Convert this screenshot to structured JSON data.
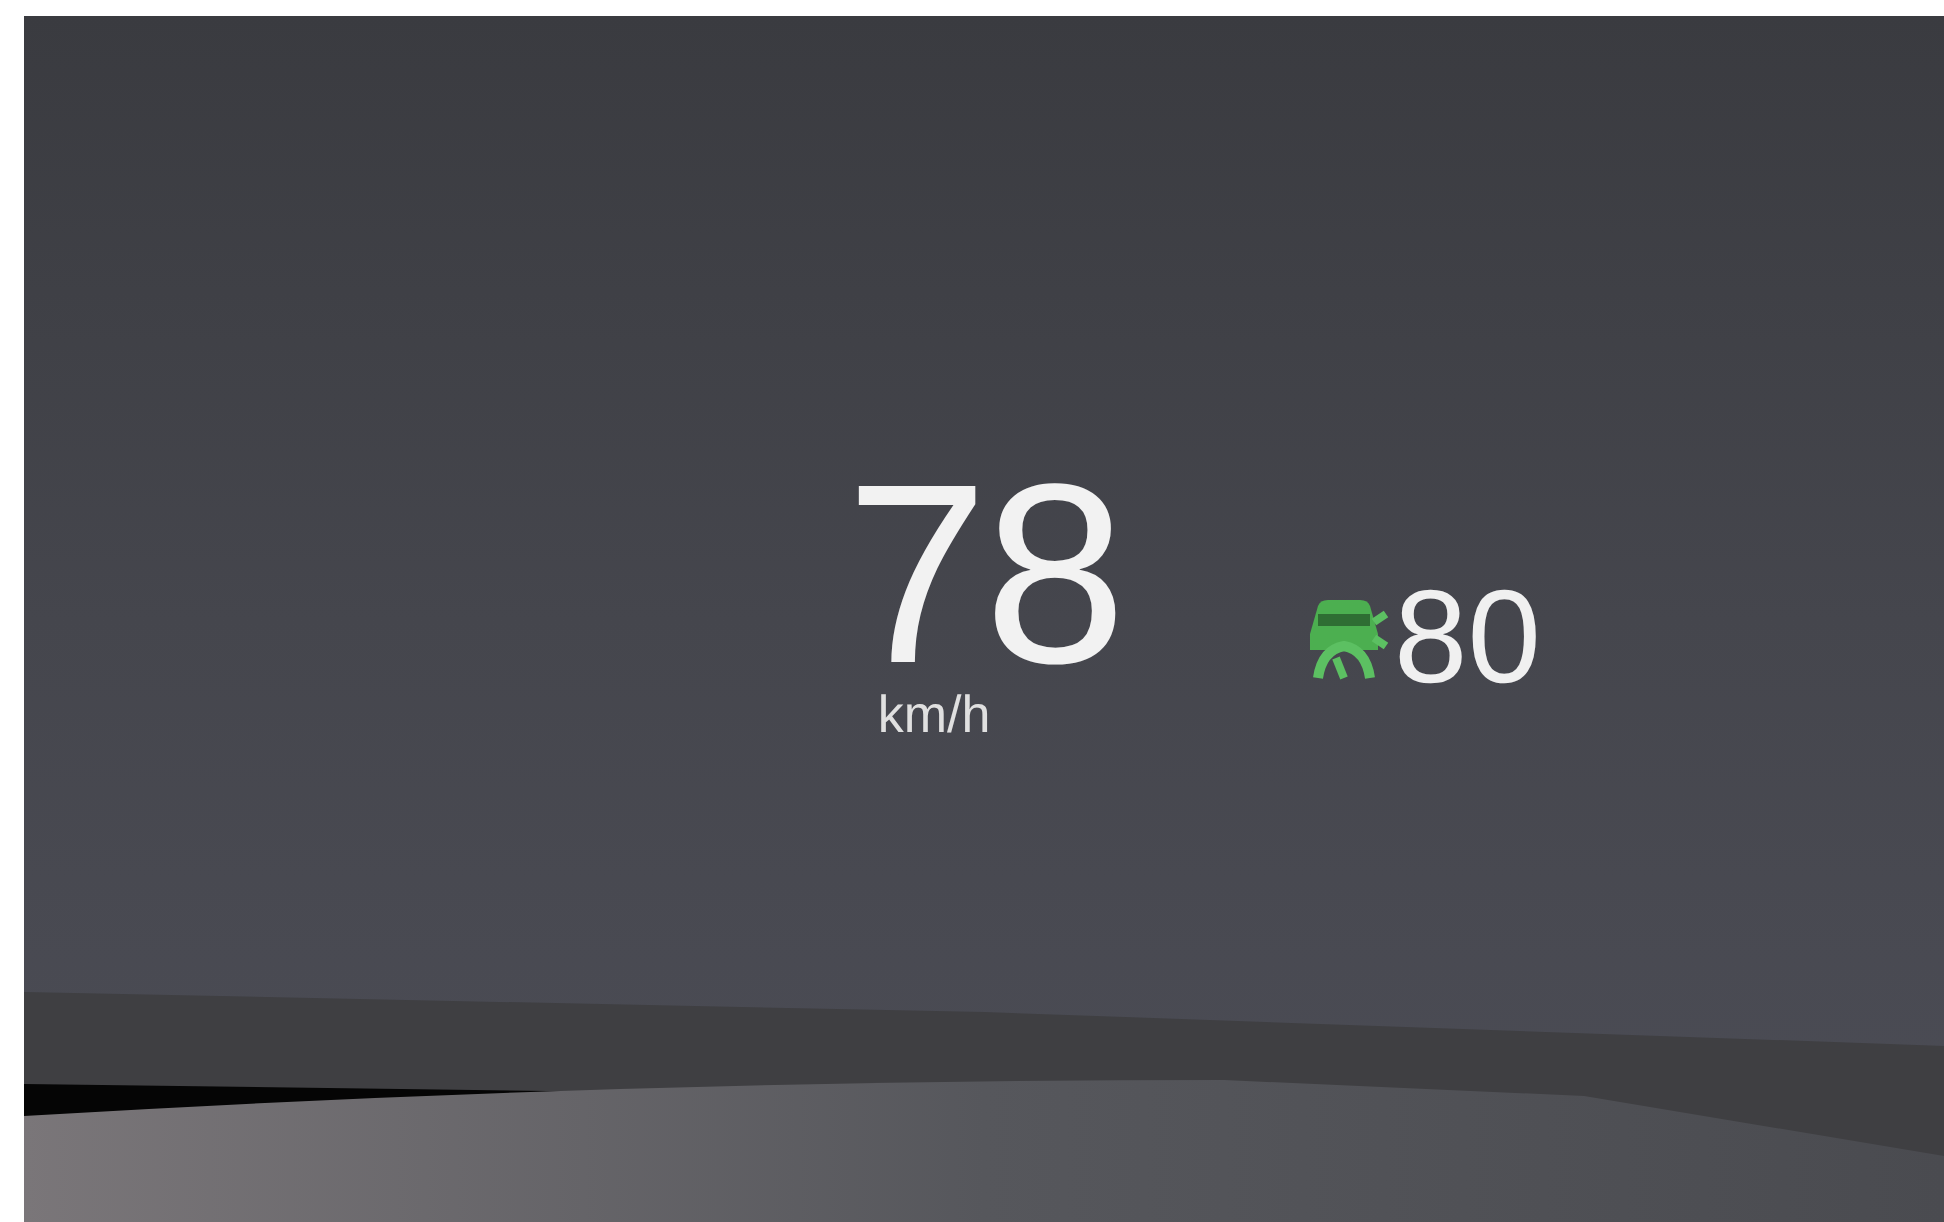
{
  "hud": {
    "speed": "78",
    "unit": "km/h",
    "speed_limit": "80"
  }
}
